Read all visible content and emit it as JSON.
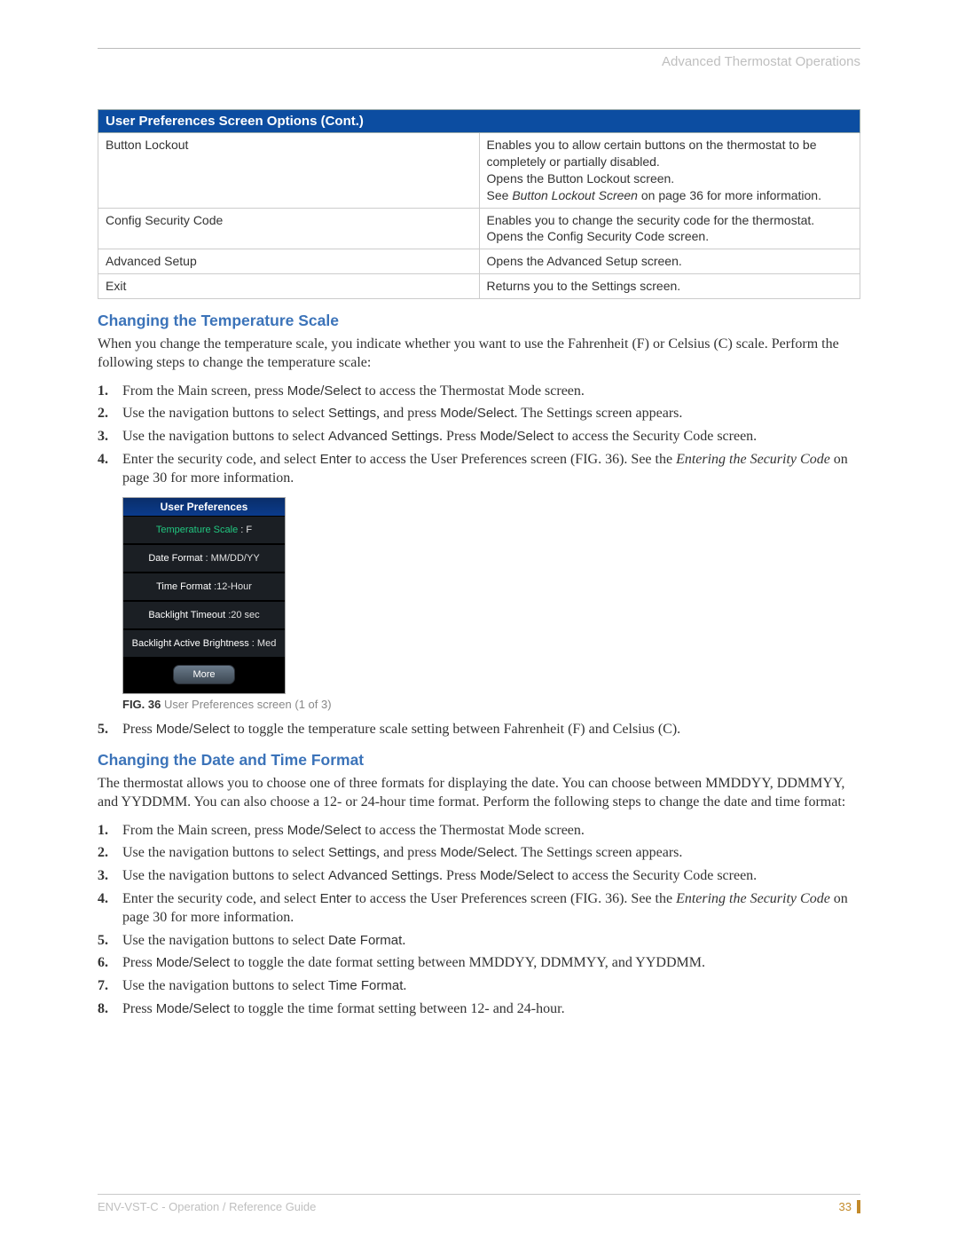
{
  "header": {
    "section": "Advanced Thermostat Operations"
  },
  "table": {
    "title": "User Preferences Screen Options (Cont.)",
    "rows": [
      {
        "label": "Button Lockout",
        "line1": "Enables you to allow certain buttons on the thermostat to be completely or partially disabled.",
        "line2": "Opens the Button Lockout screen.",
        "see_prefix": "See ",
        "see_item": "Button Lockout Screen",
        "see_suffix": "  on page 36 for more information."
      },
      {
        "label": "Config Security Code",
        "line1": "Enables you to change the security code for the thermostat.",
        "line2": "Opens the Config Security Code screen."
      },
      {
        "label": "Advanced Setup",
        "line1": "Opens the Advanced Setup screen."
      },
      {
        "label": "Exit",
        "line1": "Returns you to the Settings screen."
      }
    ]
  },
  "section1": {
    "heading": "Changing the Temperature Scale",
    "intro": "When you change the temperature scale, you indicate whether you want to use the Fahrenheit (F) or Celsius (C) scale. Perform the following steps to change the temperature scale:",
    "steps_a": [
      {
        "n": "1.",
        "pre": "From the Main screen, press ",
        "b1": "Mode/Select ",
        "post": "to access the Thermostat Mode screen."
      },
      {
        "n": "2.",
        "pre": "Use the navigation buttons to select ",
        "b1": "Settings",
        "mid": ", and press ",
        "b2": "Mode/Select",
        "post": ". The Settings screen appears."
      },
      {
        "n": "3.",
        "pre": "Use the navigation buttons to select ",
        "b1": "Advanced Settings",
        "mid": ". Press ",
        "b2": "Mode/Select ",
        "post": "to access the Security Code screen."
      },
      {
        "n": "4.",
        "pre": "Enter the security code, and select ",
        "b1": "Enter",
        "mid": " to access the User Preferences screen (FIG. 36). See the ",
        "i": "Entering the Security Code",
        "post": "  on page 30 for more information."
      }
    ],
    "steps_b": [
      {
        "n": "5.",
        "pre": "Press ",
        "b1": "Mode/Select ",
        "post": "to toggle the temperature scale setting between Fahrenheit (F) and Celsius (C)."
      }
    ]
  },
  "device": {
    "title": "User Preferences",
    "rows": [
      {
        "label": "Temperature Scale ",
        "sep": ": ",
        "val": "F",
        "selected": true
      },
      {
        "label": "Date Format ",
        "sep": ": ",
        "val": "MM/DD/YY"
      },
      {
        "label": "Time Format ",
        "sep": ":",
        "val": "12-Hour"
      },
      {
        "label": "Backlight Timeout ",
        "sep": ":",
        "val": "20 sec"
      },
      {
        "label": "Backlight Active Brightness ",
        "sep": ": ",
        "val": "Med"
      }
    ],
    "more": "More"
  },
  "fig": {
    "label": "FIG. 36",
    "caption": "  User Preferences screen (1 of 3)"
  },
  "section2": {
    "heading": "Changing the Date and Time Format",
    "intro": "The thermostat allows you to choose one of three formats for displaying the date. You can choose between MMDDYY, DDMMYY, and YYDDMM. You can also choose a 12- or 24-hour time format. Perform the following steps to change the date and time format:",
    "steps": [
      {
        "n": "1.",
        "pre": "From the Main screen, press ",
        "b1": "Mode/Select ",
        "post": "to access the Thermostat Mode screen."
      },
      {
        "n": "2.",
        "pre": "Use the navigation buttons to select ",
        "b1": "Settings",
        "mid": ", and press ",
        "b2": "Mode/Select",
        "post": ". The Settings screen appears."
      },
      {
        "n": "3.",
        "pre": "Use the navigation buttons to select ",
        "b1": "Advanced Settings",
        "mid": ". Press ",
        "b2": "Mode/Select ",
        "post": "to access the Security Code screen."
      },
      {
        "n": "4.",
        "pre": "Enter the security code, and select ",
        "b1": "Enter",
        "mid": " to access the User Preferences screen (FIG. 36). See the ",
        "i": "Entering the Security Code",
        "post": "  on page 30 for more information."
      },
      {
        "n": "5.",
        "pre": "Use the navigation buttons to select ",
        "b1": "Date Format",
        "post": "."
      },
      {
        "n": "6.",
        "pre": "Press ",
        "b1": "Mode/Select ",
        "post": "to toggle the date format setting between MMDDYY, DDMMYY, and YYDDMM."
      },
      {
        "n": "7.",
        "pre": "Use the navigation buttons to select ",
        "b1": "Time Format",
        "post": "."
      },
      {
        "n": "8.",
        "pre": "Press ",
        "b1": "Mode/Select ",
        "post": "to toggle the time format setting between 12- and 24-hour."
      }
    ]
  },
  "footer": {
    "doc": "ENV-VST-C - Operation / Reference Guide",
    "page": "33"
  }
}
